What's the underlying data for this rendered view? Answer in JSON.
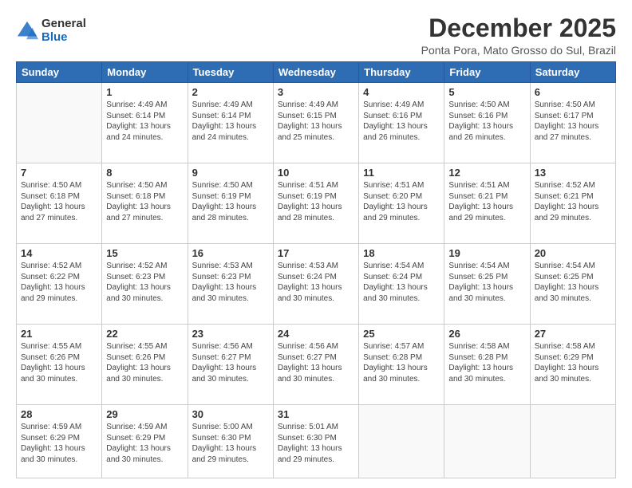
{
  "logo": {
    "general": "General",
    "blue": "Blue"
  },
  "title": "December 2025",
  "location": "Ponta Pora, Mato Grosso do Sul, Brazil",
  "headers": [
    "Sunday",
    "Monday",
    "Tuesday",
    "Wednesday",
    "Thursday",
    "Friday",
    "Saturday"
  ],
  "weeks": [
    [
      {
        "day": "",
        "info": ""
      },
      {
        "day": "1",
        "info": "Sunrise: 4:49 AM\nSunset: 6:14 PM\nDaylight: 13 hours\nand 24 minutes."
      },
      {
        "day": "2",
        "info": "Sunrise: 4:49 AM\nSunset: 6:14 PM\nDaylight: 13 hours\nand 24 minutes."
      },
      {
        "day": "3",
        "info": "Sunrise: 4:49 AM\nSunset: 6:15 PM\nDaylight: 13 hours\nand 25 minutes."
      },
      {
        "day": "4",
        "info": "Sunrise: 4:49 AM\nSunset: 6:16 PM\nDaylight: 13 hours\nand 26 minutes."
      },
      {
        "day": "5",
        "info": "Sunrise: 4:50 AM\nSunset: 6:16 PM\nDaylight: 13 hours\nand 26 minutes."
      },
      {
        "day": "6",
        "info": "Sunrise: 4:50 AM\nSunset: 6:17 PM\nDaylight: 13 hours\nand 27 minutes."
      }
    ],
    [
      {
        "day": "7",
        "info": "Sunrise: 4:50 AM\nSunset: 6:18 PM\nDaylight: 13 hours\nand 27 minutes."
      },
      {
        "day": "8",
        "info": "Sunrise: 4:50 AM\nSunset: 6:18 PM\nDaylight: 13 hours\nand 27 minutes."
      },
      {
        "day": "9",
        "info": "Sunrise: 4:50 AM\nSunset: 6:19 PM\nDaylight: 13 hours\nand 28 minutes."
      },
      {
        "day": "10",
        "info": "Sunrise: 4:51 AM\nSunset: 6:19 PM\nDaylight: 13 hours\nand 28 minutes."
      },
      {
        "day": "11",
        "info": "Sunrise: 4:51 AM\nSunset: 6:20 PM\nDaylight: 13 hours\nand 29 minutes."
      },
      {
        "day": "12",
        "info": "Sunrise: 4:51 AM\nSunset: 6:21 PM\nDaylight: 13 hours\nand 29 minutes."
      },
      {
        "day": "13",
        "info": "Sunrise: 4:52 AM\nSunset: 6:21 PM\nDaylight: 13 hours\nand 29 minutes."
      }
    ],
    [
      {
        "day": "14",
        "info": "Sunrise: 4:52 AM\nSunset: 6:22 PM\nDaylight: 13 hours\nand 29 minutes."
      },
      {
        "day": "15",
        "info": "Sunrise: 4:52 AM\nSunset: 6:23 PM\nDaylight: 13 hours\nand 30 minutes."
      },
      {
        "day": "16",
        "info": "Sunrise: 4:53 AM\nSunset: 6:23 PM\nDaylight: 13 hours\nand 30 minutes."
      },
      {
        "day": "17",
        "info": "Sunrise: 4:53 AM\nSunset: 6:24 PM\nDaylight: 13 hours\nand 30 minutes."
      },
      {
        "day": "18",
        "info": "Sunrise: 4:54 AM\nSunset: 6:24 PM\nDaylight: 13 hours\nand 30 minutes."
      },
      {
        "day": "19",
        "info": "Sunrise: 4:54 AM\nSunset: 6:25 PM\nDaylight: 13 hours\nand 30 minutes."
      },
      {
        "day": "20",
        "info": "Sunrise: 4:54 AM\nSunset: 6:25 PM\nDaylight: 13 hours\nand 30 minutes."
      }
    ],
    [
      {
        "day": "21",
        "info": "Sunrise: 4:55 AM\nSunset: 6:26 PM\nDaylight: 13 hours\nand 30 minutes."
      },
      {
        "day": "22",
        "info": "Sunrise: 4:55 AM\nSunset: 6:26 PM\nDaylight: 13 hours\nand 30 minutes."
      },
      {
        "day": "23",
        "info": "Sunrise: 4:56 AM\nSunset: 6:27 PM\nDaylight: 13 hours\nand 30 minutes."
      },
      {
        "day": "24",
        "info": "Sunrise: 4:56 AM\nSunset: 6:27 PM\nDaylight: 13 hours\nand 30 minutes."
      },
      {
        "day": "25",
        "info": "Sunrise: 4:57 AM\nSunset: 6:28 PM\nDaylight: 13 hours\nand 30 minutes."
      },
      {
        "day": "26",
        "info": "Sunrise: 4:58 AM\nSunset: 6:28 PM\nDaylight: 13 hours\nand 30 minutes."
      },
      {
        "day": "27",
        "info": "Sunrise: 4:58 AM\nSunset: 6:29 PM\nDaylight: 13 hours\nand 30 minutes."
      }
    ],
    [
      {
        "day": "28",
        "info": "Sunrise: 4:59 AM\nSunset: 6:29 PM\nDaylight: 13 hours\nand 30 minutes."
      },
      {
        "day": "29",
        "info": "Sunrise: 4:59 AM\nSunset: 6:29 PM\nDaylight: 13 hours\nand 30 minutes."
      },
      {
        "day": "30",
        "info": "Sunrise: 5:00 AM\nSunset: 6:30 PM\nDaylight: 13 hours\nand 29 minutes."
      },
      {
        "day": "31",
        "info": "Sunrise: 5:01 AM\nSunset: 6:30 PM\nDaylight: 13 hours\nand 29 minutes."
      },
      {
        "day": "",
        "info": ""
      },
      {
        "day": "",
        "info": ""
      },
      {
        "day": "",
        "info": ""
      }
    ]
  ]
}
